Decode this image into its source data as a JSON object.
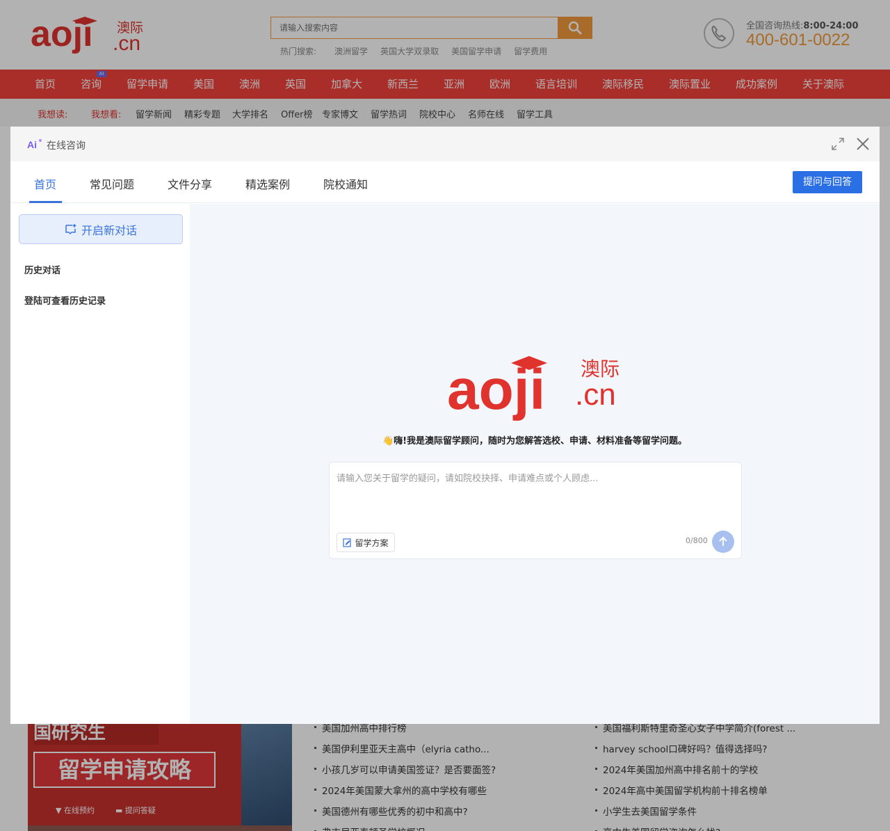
{
  "brand": {
    "logo_text": "aoji",
    "logo_cn": "澳际",
    "logo_domain": ".cn",
    "color": "#e0332d"
  },
  "search": {
    "placeholder": "请输入搜索内容",
    "hot_label": "热门搜索:",
    "hot_terms": [
      "澳洲留学",
      "英国大学双录取",
      "美国留学申请",
      "留学费用"
    ]
  },
  "hotline": {
    "label": "全国咨询热线:",
    "hours": "8:00-24:00",
    "number": "400-601-0022"
  },
  "nav": {
    "items": [
      "首页",
      "咨询",
      "留学申请",
      "美国",
      "澳洲",
      "英国",
      "加拿大",
      "新西兰",
      "亚洲",
      "欧洲",
      "语言培训",
      "澳际移民",
      "澳际置业",
      "成功案例",
      "关于澳际"
    ],
    "ai_badge": "AI"
  },
  "subnav": {
    "read_label": "我想读:",
    "see_label": "我想看:",
    "links": [
      "留学新闻",
      "精彩专题",
      "大学排名",
      "Offer榜",
      "专家博文",
      "留学热词",
      "院校中心",
      "名师在线",
      "留学工具"
    ]
  },
  "banner": {
    "top_text": "国研究生",
    "title": "留学申请攻略",
    "link1": "在线预约",
    "link2": "提问答疑"
  },
  "news": {
    "left": [
      "美国加州高中排行榜",
      "美国伊利里亚天主高中（elyria catho...",
      "小孩几岁可以申请美国签证？是否要面签?",
      "2024年美国蒙大拿州的高中学校有哪些",
      "美国德州有哪些优秀的初中和高中?",
      "弗吉尼亚泰顿圣学校概况"
    ],
    "right": [
      "美国福利斯特里奇圣心女子中学简介(forest ...",
      "harvey school口碑好吗？值得选择吗?",
      "2024年美国加州高中排名前十的学校",
      "2024年高中美国留学机构前十排名榜单",
      "小学生去美国留学条件",
      "高中生美国留学咨询怎么找?"
    ]
  },
  "modal": {
    "title": "在线咨询",
    "tabs": [
      "首页",
      "常见问题",
      "文件分享",
      "精选案例",
      "院校通知"
    ],
    "active_tab": "首页",
    "ask_button": "提问与回答",
    "new_chat": "开启新对话",
    "history_label": "历史对话",
    "login_hint": "登陆可查看历史记录",
    "welcome": "👋嗨!我是澳际留学顾问，随时为您解答选校、申请、材料准备等留学问题。",
    "input_placeholder": "请输入您关于留学的疑问，请如院校抉择、申请难点或个人顾虑...",
    "plan_button": "留学方案",
    "counter": "0/800"
  },
  "colors": {
    "nav_bg": "#f2433d",
    "accent_orange": "#f19a3c",
    "primary_blue": "#2b6fe4"
  }
}
